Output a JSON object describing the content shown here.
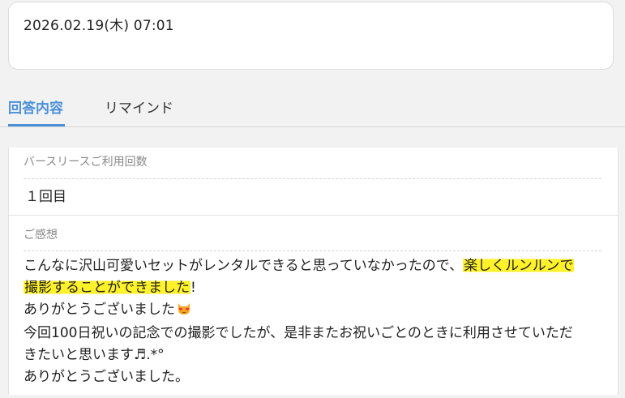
{
  "header": {
    "datetime": "2026.02.19(木) 07:01"
  },
  "tabs": [
    {
      "label": "回答内容",
      "active": true
    },
    {
      "label": "リマインド",
      "active": false
    }
  ],
  "answers": {
    "usage_count_label": "バースリースご利用回数",
    "usage_count_value": "１回目",
    "impression_label": "ご感想",
    "comment": {
      "line1_plain": "こんなに沢山可愛いセットがレンタルできると思っていなかったので、",
      "line1_highlight": "楽しくルンルンで",
      "line2_highlight": "撮影することができました",
      "line2_plain": "!",
      "line3": "ありがとうございました",
      "line4": "今回100日祝いの記念での撮影でしたが、是非またお祝いごとのときに利用させていただ",
      "line5": "きたいと思います♬.*°",
      "line6": "ありがとうございました。"
    }
  },
  "colors": {
    "accent": "#4a90d9",
    "highlight": "#fff22a",
    "label_gray": "#8a8a8a"
  },
  "icons": {
    "emoji": "heart-eyes-cat-emoji"
  }
}
